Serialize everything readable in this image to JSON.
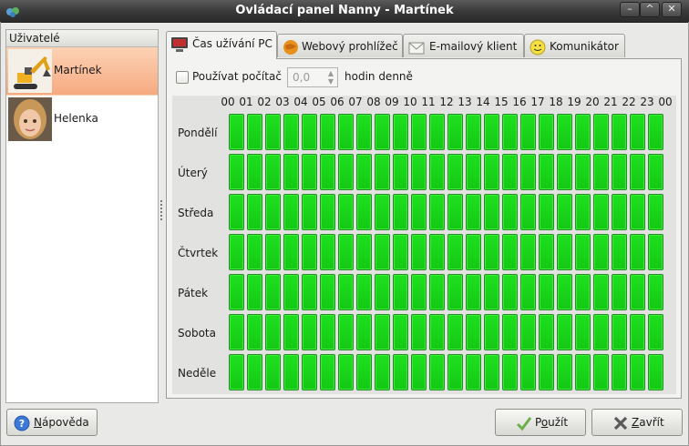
{
  "window": {
    "title": "Ovládací panel Nanny - Martínek"
  },
  "users": {
    "header": "Uživatelé",
    "items": [
      {
        "name": "Martínek",
        "selected": true
      },
      {
        "name": "Helenka",
        "selected": false
      }
    ]
  },
  "tabs": [
    {
      "label": "Čas užívání PC",
      "icon": "monitor-icon",
      "active": true
    },
    {
      "label": "Webový prohlížeč",
      "icon": "globe-icon",
      "active": false
    },
    {
      "label": "E-mailový klient",
      "icon": "envelope-icon",
      "active": false
    },
    {
      "label": "Komunikátor",
      "icon": "smiley-icon",
      "active": false
    }
  ],
  "usage": {
    "checkbox_label": "Používat počítač",
    "checked": false,
    "hours_value": "0,0",
    "hours_suffix": "hodin denně"
  },
  "schedule": {
    "hours": [
      "00",
      "01",
      "02",
      "03",
      "04",
      "05",
      "06",
      "07",
      "08",
      "09",
      "10",
      "11",
      "12",
      "13",
      "14",
      "15",
      "16",
      "17",
      "18",
      "19",
      "20",
      "21",
      "22",
      "23",
      "00"
    ],
    "days": [
      "Pondělí",
      "Úterý",
      "Středa",
      "Čtvrtek",
      "Pátek",
      "Sobota",
      "Neděle"
    ],
    "allowed_color": "#14c814"
  },
  "buttons": {
    "help": "Nápověda",
    "apply": "Použít",
    "close": "Zavřít"
  }
}
